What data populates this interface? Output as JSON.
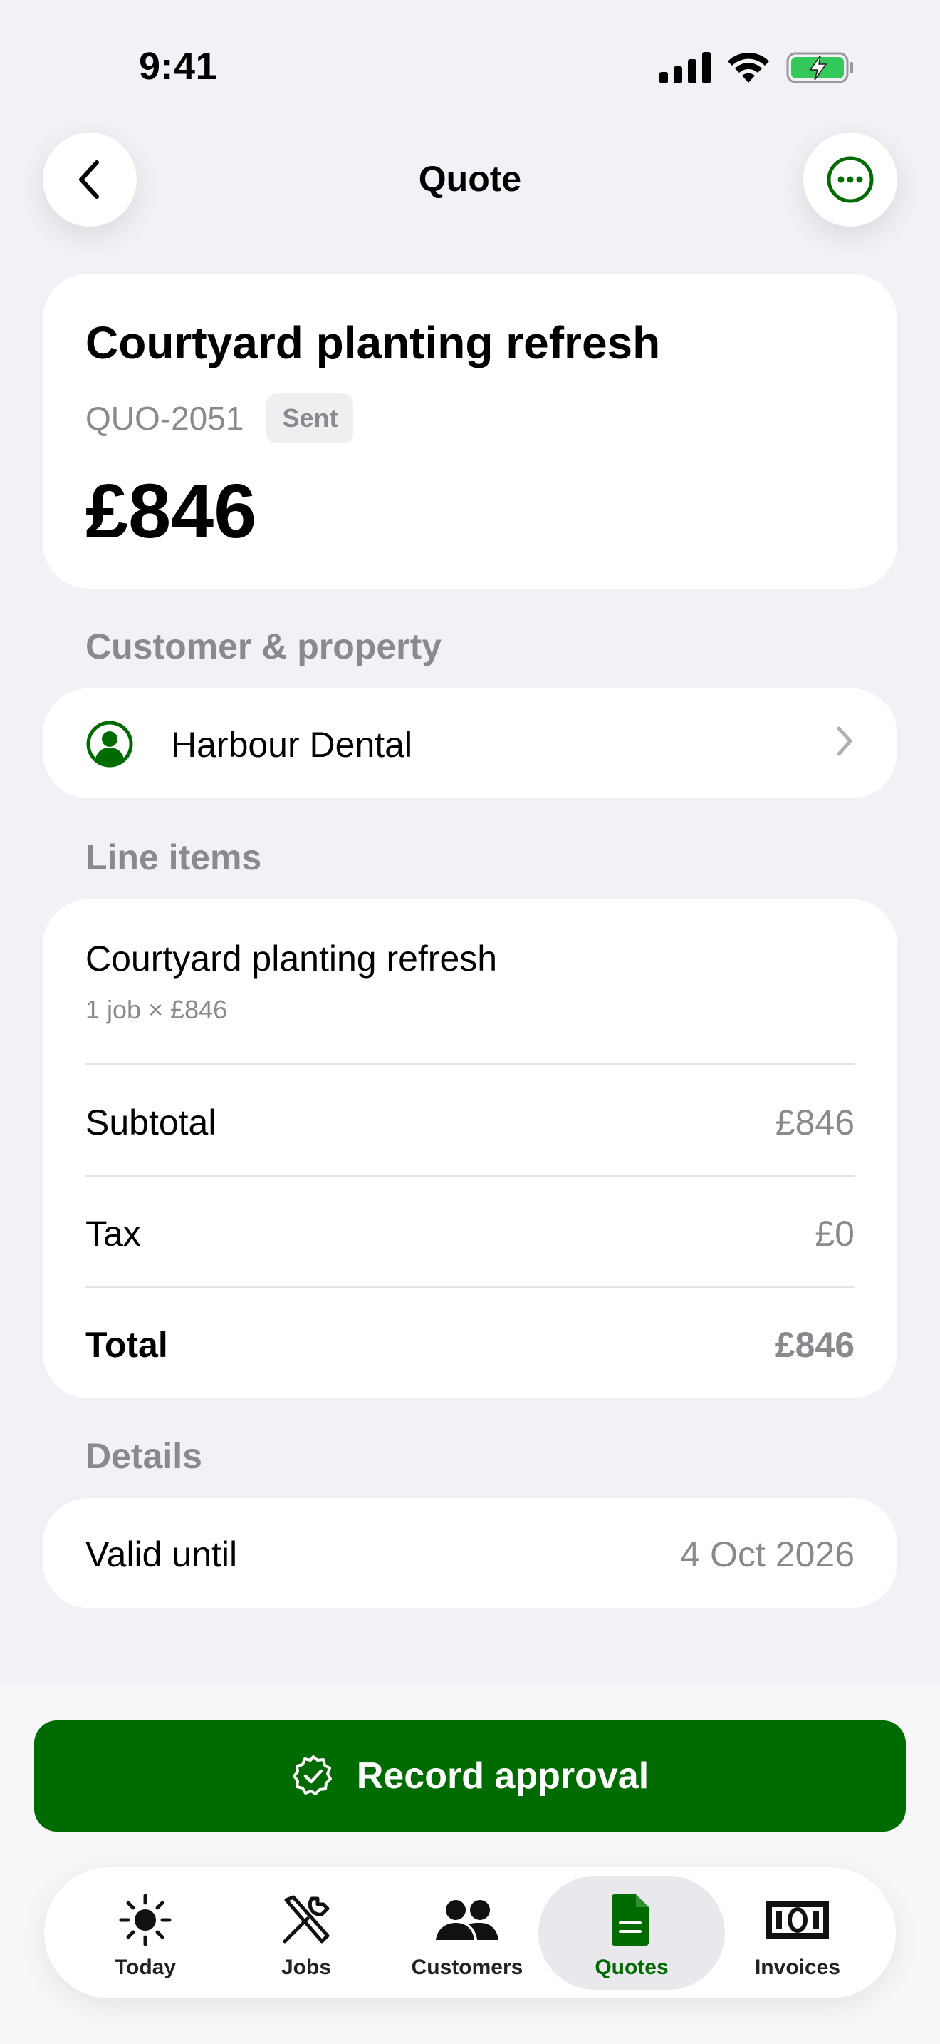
{
  "status_bar": {
    "time": "9:41"
  },
  "nav": {
    "title": "Quote"
  },
  "quote": {
    "title": "Courtyard planting refresh",
    "number": "QUO-2051",
    "status": "Sent",
    "total": "£846"
  },
  "sections": {
    "customer_label": "Customer & property",
    "line_items_label": "Line items",
    "details_label": "Details"
  },
  "customer": {
    "name": "Harbour Dental"
  },
  "line_items": {
    "item_title": "Courtyard planting refresh",
    "item_sub": "1 job × £846",
    "subtotal_label": "Subtotal",
    "subtotal_value": "£846",
    "tax_label": "Tax",
    "tax_value": "£0",
    "total_label": "Total",
    "total_value": "£846"
  },
  "details": {
    "valid_label": "Valid until",
    "valid_value": "4 Oct 2026"
  },
  "cta": {
    "label": "Record approval"
  },
  "tabs": [
    {
      "label": "Today",
      "icon": "sun-icon"
    },
    {
      "label": "Jobs",
      "icon": "tools-icon"
    },
    {
      "label": "Customers",
      "icon": "people-icon"
    },
    {
      "label": "Quotes",
      "icon": "document-icon",
      "active": true
    },
    {
      "label": "Invoices",
      "icon": "banknote-icon"
    }
  ],
  "colors": {
    "accent": "#006b00",
    "background": "#f1f1f6",
    "muted": "#8a8a8e"
  }
}
